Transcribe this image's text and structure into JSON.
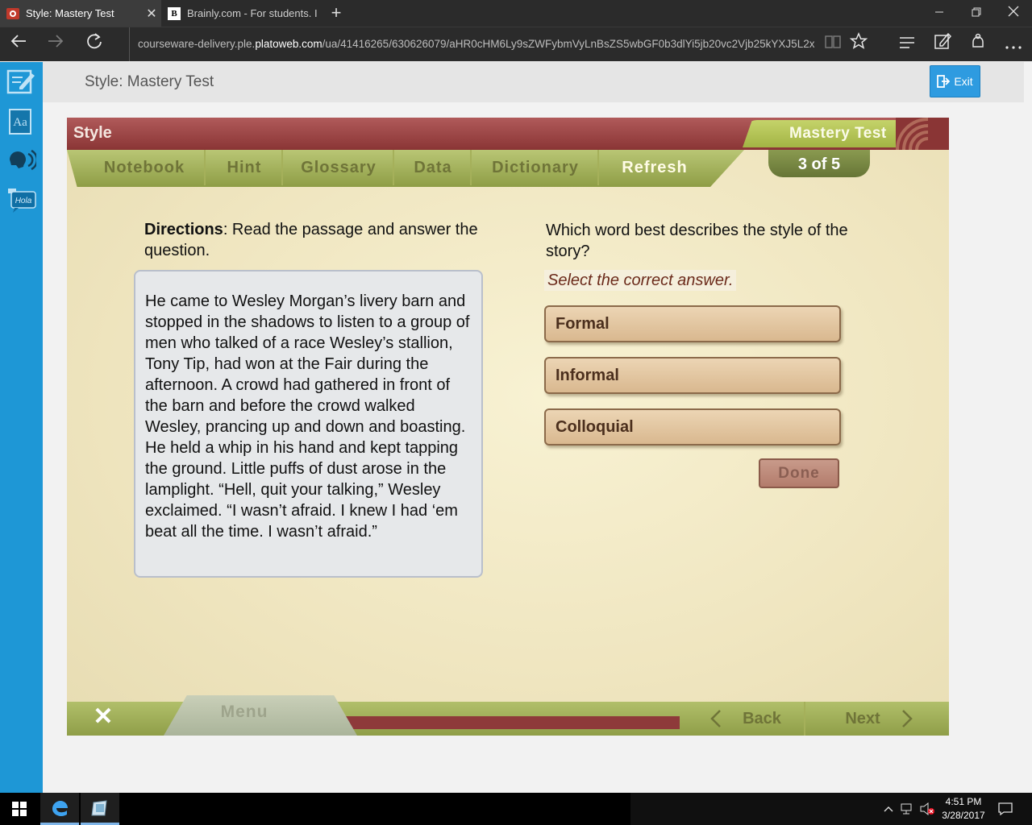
{
  "browser": {
    "tabs": [
      {
        "title": "Style: Mastery Test",
        "active": true
      },
      {
        "title": "Brainly.com - For students. I",
        "active": false
      }
    ],
    "url_prefix": "courseware-delivery.ple.",
    "url_domain": "platoweb.com",
    "url_rest": "/ua/41416265/630626079/aHR0cHM6Ly9sZWFybmVyLnBsZS5wbGF0b3dlYi5jb20vc2Vjb25kYXJ5L2xlYXJuaW",
    "close_tab_glyph": "✕",
    "new_tab_glyph": "+"
  },
  "header": {
    "title": "Style: Mastery Test",
    "exit_label": "Exit"
  },
  "activity": {
    "section": "Style",
    "badge": "Mastery Test",
    "counter": "3 of 5",
    "tools": [
      "Notebook",
      "Hint",
      "Glossary",
      "Data",
      "Dictionary",
      "Refresh"
    ],
    "directions_label": "Directions",
    "directions_text": ": Read the passage and answer the question.",
    "passage": "He came to Wesley Morgan’s livery barn and stopped in the shadows to listen to a group of men who talked of a race Wesley’s stallion, Tony Tip, had won at the Fair during the afternoon. A crowd had gathered in front of the barn and before the crowd walked Wesley, prancing up and down and boasting. He held a whip in his hand and kept tapping the ground. Little puffs of dust arose in the lamplight. “Hell, quit your talking,” Wesley exclaimed. “I wasn’t afraid. I knew I had ‘em beat all the time. I wasn’t afraid.”",
    "question": "Which word best describes the style of the story?",
    "instruction": "Select the correct answer.",
    "options": [
      "Formal",
      "Informal",
      "Colloquial"
    ],
    "done_label": "Done",
    "menu_label": "Menu",
    "back_label": "Back",
    "next_label": "Next",
    "close_glyph": "✕"
  },
  "rail": {
    "icons": [
      "notebook-edit-icon",
      "glossary-icon",
      "text-to-speech-icon",
      "translation-icon"
    ],
    "translation_text": "Hola",
    "glossary_text": "Aa"
  },
  "taskbar": {
    "time": "4:51 PM",
    "date": "3/28/2017"
  },
  "colors": {
    "rail": "#1e97d6",
    "exit_button": "#2e9be0",
    "activity_red": "#8a3535",
    "activity_green": "#a3b444",
    "option_tan": "#e2c6a0"
  }
}
